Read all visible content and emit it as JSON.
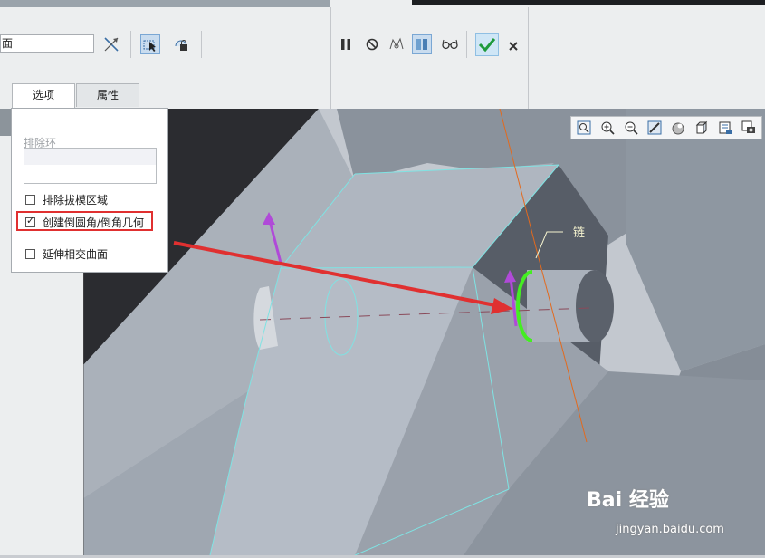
{
  "ribbon": {
    "combo_value": "面",
    "tabs": [
      {
        "label": "选项",
        "active": true
      },
      {
        "label": "属性",
        "active": false
      }
    ],
    "icons": [
      "axis-arrow-icon",
      "select-arrow-icon",
      "lock-select-icon",
      "pause-icon",
      "stop-icon",
      "preview-geometry-icon",
      "verify-icon",
      "glasses-icon",
      "ok-check-icon",
      "cancel-x-icon"
    ]
  },
  "options_panel": {
    "exclude_loop_label": "排除环",
    "checkboxes": [
      {
        "label": "排除拔模区域",
        "checked": false
      },
      {
        "label": "创建倒圆角/倒角几何",
        "checked": true
      },
      {
        "label": "延伸相交曲面",
        "checked": false
      }
    ]
  },
  "viewport": {
    "chain_label": "链",
    "view_toolbar_icons": [
      "zoom-fit-icon",
      "zoom-in-icon",
      "zoom-out-icon",
      "repaint-icon",
      "display-style-icon",
      "saved-views-icon",
      "view-manager-icon",
      "screenshot-icon"
    ]
  },
  "watermark": {
    "brand": "Bai 经验",
    "url": "jingyan.baidu.com"
  },
  "colors": {
    "annotation_red": "#e03030",
    "edge_cyan": "#7fe3e3",
    "chain_green": "#44ee22",
    "arrow_purple": "#b04ad8"
  }
}
